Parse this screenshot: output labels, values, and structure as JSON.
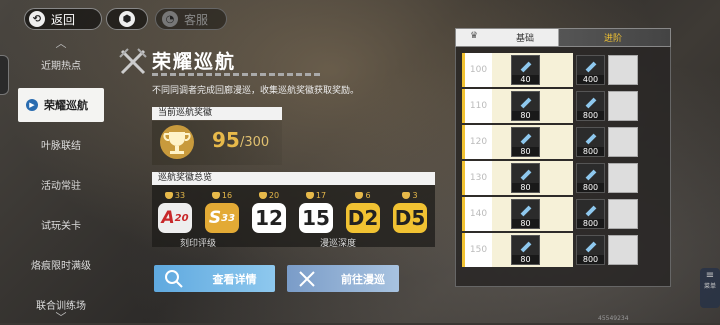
{
  "topbar": {
    "back_label": "返回",
    "service_label": "客服"
  },
  "sidebar": {
    "items": [
      {
        "label": "近期热点"
      },
      {
        "label": "荣耀巡航"
      },
      {
        "label": "叶脉联结"
      },
      {
        "label": "活动常驻"
      },
      {
        "label": "试玩关卡"
      },
      {
        "label": "烙痕限时满级"
      },
      {
        "label": "联合训练场"
      }
    ]
  },
  "main": {
    "title": "荣耀巡航",
    "description": "不同同调者完成回廊漫巡，收集巡航奖徽获取奖励。",
    "current_label": "当前巡航奖徽",
    "current_value": "95",
    "current_max": "/300",
    "overview_label": "巡航奖徽总览",
    "overview": [
      {
        "count": "33",
        "badge_main": "A",
        "badge_sub": "20"
      },
      {
        "count": "16",
        "badge_main": "S",
        "badge_sub": "33"
      },
      {
        "count": "20",
        "badge_main": "12",
        "badge_sub": ""
      },
      {
        "count": "17",
        "badge_main": "15",
        "badge_sub": ""
      },
      {
        "count": "6",
        "badge_main": "D2",
        "badge_sub": ""
      },
      {
        "count": "3",
        "badge_main": "D5",
        "badge_sub": ""
      }
    ],
    "sub_labels": {
      "left": "刻印评级",
      "right": "漫巡深度"
    },
    "detail_button": "查看详情",
    "goto_button": "前往漫巡"
  },
  "rewards": {
    "header_base": "基础",
    "header_adv": "进阶",
    "rows": [
      {
        "level": "100",
        "base_qty": "40",
        "adv_qty": "400"
      },
      {
        "level": "110",
        "base_qty": "80",
        "adv_qty": "800"
      },
      {
        "level": "120",
        "base_qty": "80",
        "adv_qty": "800"
      },
      {
        "level": "130",
        "base_qty": "80",
        "adv_qty": "800"
      },
      {
        "level": "140",
        "base_qty": "80",
        "adv_qty": "800"
      },
      {
        "level": "150",
        "base_qty": "80",
        "adv_qty": "800"
      }
    ]
  },
  "footer": {
    "uid": "45549234",
    "menu_label": "菜单"
  },
  "colors": {
    "gold": "#e7b94a",
    "accent_blue": "#5fa9df",
    "active_bg": "#f4f4f2"
  }
}
